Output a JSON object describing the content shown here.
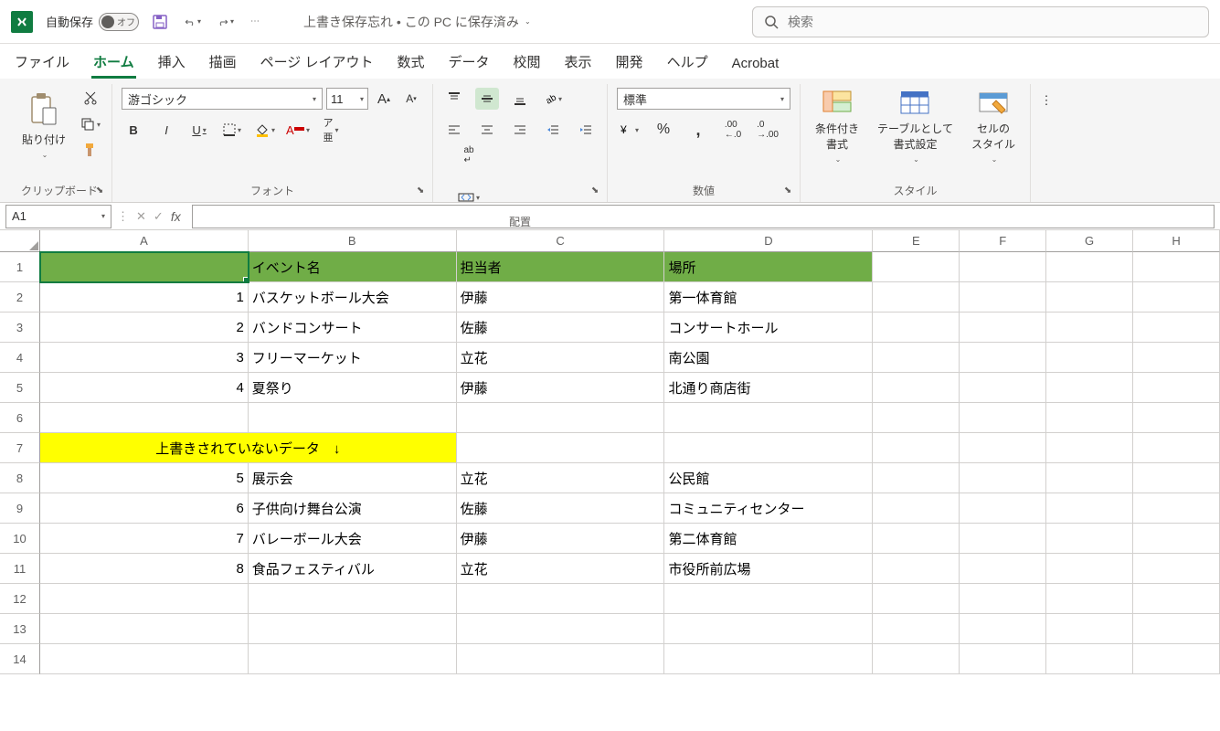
{
  "titlebar": {
    "autosave_label": "自動保存",
    "autosave_off": "オフ",
    "doc_title": "上書き保存忘れ • この PC に保存済み",
    "search_placeholder": "検索"
  },
  "tabs": [
    "ファイル",
    "ホーム",
    "挿入",
    "描画",
    "ページ レイアウト",
    "数式",
    "データ",
    "校閲",
    "表示",
    "開発",
    "ヘルプ",
    "Acrobat"
  ],
  "active_tab_index": 1,
  "ribbon": {
    "clipboard": {
      "paste": "貼り付け",
      "label": "クリップボード"
    },
    "font": {
      "name": "游ゴシック",
      "size": "11",
      "label": "フォント"
    },
    "alignment": {
      "label": "配置"
    },
    "number": {
      "format": "標準",
      "label": "数値"
    },
    "styles": {
      "cond": "条件付き\n書式",
      "table": "テーブルとして\n書式設定",
      "cell": "セルの\nスタイル",
      "label": "スタイル"
    }
  },
  "namebox": "A1",
  "formula": "",
  "columns": [
    "A",
    "B",
    "C",
    "D",
    "E",
    "F",
    "G",
    "H"
  ],
  "col_widths": [
    "w-a",
    "w-b",
    "w-c",
    "w-d",
    "w-e",
    "w-f",
    "w-g",
    "w-h"
  ],
  "sheet": {
    "r1": {
      "b": "イベント名",
      "c": "担当者",
      "d": "場所"
    },
    "r2": {
      "a": "1",
      "b": "バスケットボール大会",
      "c": "伊藤",
      "d": "第一体育館"
    },
    "r3": {
      "a": "2",
      "b": "バンドコンサート",
      "c": "佐藤",
      "d": "コンサートホール"
    },
    "r4": {
      "a": "3",
      "b": "フリーマーケット",
      "c": "立花",
      "d": "南公園"
    },
    "r5": {
      "a": "4",
      "b": "夏祭り",
      "c": "伊藤",
      "d": "北通り商店街"
    },
    "r7": {
      "ab": "上書きされていないデータ　↓"
    },
    "r8": {
      "a": "5",
      "b": "展示会",
      "c": "立花",
      "d": "公民館"
    },
    "r9": {
      "a": "6",
      "b": "子供向け舞台公演",
      "c": "佐藤",
      "d": "コミュニティセンター"
    },
    "r10": {
      "a": "7",
      "b": "バレーボール大会",
      "c": "伊藤",
      "d": "第二体育館"
    },
    "r11": {
      "a": "8",
      "b": "食品フェスティバル",
      "c": "立花",
      "d": "市役所前広場"
    }
  }
}
